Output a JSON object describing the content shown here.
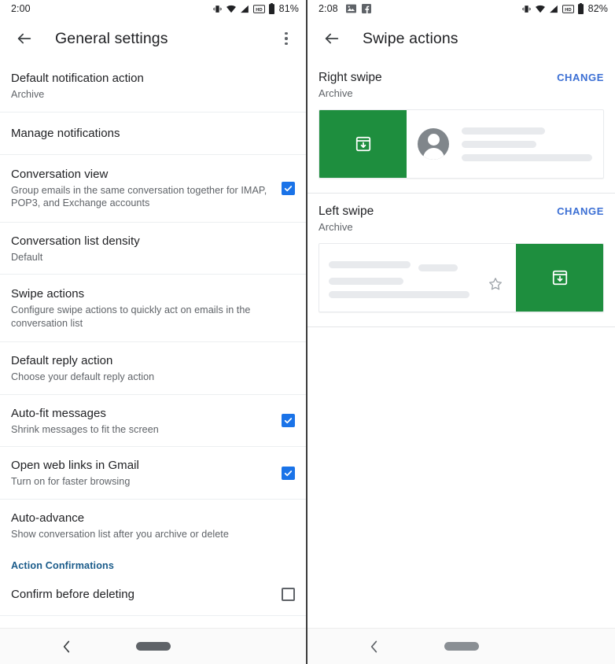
{
  "left_phone": {
    "status": {
      "time": "2:00",
      "battery": "81%",
      "icons": [
        "vibrate-icon",
        "wifi-icon",
        "signal-icon",
        "hd-icon",
        "battery-icon"
      ]
    },
    "appbar": {
      "title": "General settings",
      "back_icon": "back-arrow-icon",
      "overflow_icon": "overflow-menu-icon"
    },
    "rows": [
      {
        "title": "Default notification action",
        "sub": "Archive",
        "control": "none"
      },
      {
        "title": "Manage notifications",
        "sub": "",
        "control": "none"
      },
      {
        "title": "Conversation view",
        "sub": "Group emails in the same conversation together for IMAP, POP3, and Exchange accounts",
        "control": "checkbox",
        "checked": true
      },
      {
        "title": "Conversation list density",
        "sub": "Default",
        "control": "none"
      },
      {
        "title": "Swipe actions",
        "sub": "Configure swipe actions to quickly act on emails in the conversation list",
        "control": "none"
      },
      {
        "title": "Default reply action",
        "sub": "Choose your default reply action",
        "control": "none"
      },
      {
        "title": "Auto-fit messages",
        "sub": "Shrink messages to fit the screen",
        "control": "checkbox",
        "checked": true
      },
      {
        "title": "Open web links in Gmail",
        "sub": "Turn on for faster browsing",
        "control": "checkbox",
        "checked": true
      },
      {
        "title": "Auto-advance",
        "sub": "Show conversation list after you archive or delete",
        "control": "none"
      }
    ],
    "section_header": "Action Confirmations",
    "confirm_row": {
      "title": "Confirm before deleting",
      "control": "checkbox",
      "checked": false
    },
    "navbar": {
      "back_icon": "nav-back-icon",
      "home_pill": "nav-home-pill"
    }
  },
  "right_phone": {
    "status": {
      "time": "2:08",
      "battery": "82%",
      "left_icons": [
        "screenshot-icon",
        "facebook-icon"
      ],
      "icons": [
        "vibrate-icon",
        "wifi-icon",
        "signal-icon",
        "hd-icon",
        "battery-icon"
      ]
    },
    "appbar": {
      "title": "Swipe actions",
      "back_icon": "back-arrow-icon"
    },
    "sections": [
      {
        "title": "Right swipe",
        "sub": "Archive",
        "change_label": "CHANGE",
        "action_icon": "archive-icon",
        "direction": "right",
        "green_color": "#1e8e3e"
      },
      {
        "title": "Left swipe",
        "sub": "Archive",
        "change_label": "CHANGE",
        "action_icon": "archive-icon",
        "direction": "left",
        "green_color": "#1e8e3e"
      }
    ],
    "navbar": {
      "back_icon": "nav-back-icon",
      "home_pill": "nav-home-pill"
    }
  },
  "colors": {
    "accent_blue": "#1a73e8",
    "link_blue": "#3b6fd4",
    "section_blue": "#1a5b8a",
    "archive_green": "#1e8e3e",
    "text_primary": "#202124",
    "text_secondary": "#5f6368"
  }
}
